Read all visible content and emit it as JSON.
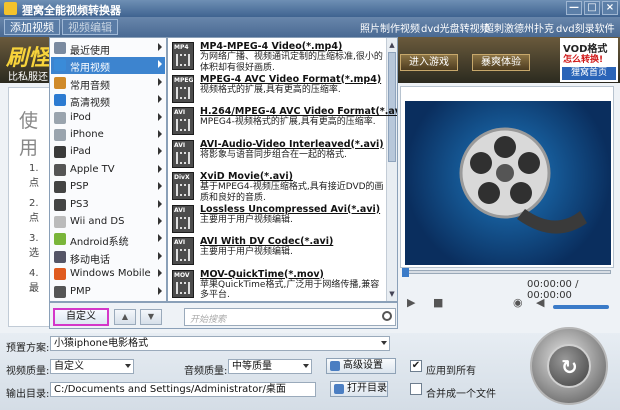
{
  "window": {
    "title": "狸窝全能视频转换器",
    "controls": [
      "—",
      "□",
      "×"
    ]
  },
  "toolbar": {
    "add_video": "添加视频",
    "video_edit": "视频编辑",
    "links": [
      "照片制作视频",
      "dvd光盘转视频",
      "超刺激德州扑克",
      "dvd刻录软件"
    ]
  },
  "banner": {
    "logo": "刷怪",
    "sub": "比私服还",
    "enter_game": "进入游戏",
    "trial": "暴爽体验",
    "vod_title": "VOD格式",
    "vod_sub": "怎么转换!",
    "vod_btn": "狸窝首页"
  },
  "leftpanel": {
    "big": "使用",
    "steps": [
      "1. 点",
      "2. 点",
      "3. 选",
      "4. 最"
    ]
  },
  "categories": [
    {
      "label": "最近使用",
      "color": "#7a8aa0"
    },
    {
      "label": "常用视频",
      "color": "#3a8bd8",
      "selected": true
    },
    {
      "label": "常用音频",
      "color": "#d08a2a"
    },
    {
      "label": "高清视频",
      "color": "#2d7bd1"
    },
    {
      "label": "iPod",
      "color": "#9aa4ae"
    },
    {
      "label": "iPhone",
      "color": "#9aa4ae"
    },
    {
      "label": "iPad",
      "color": "#3b3b3b"
    },
    {
      "label": "Apple TV",
      "color": "#555"
    },
    {
      "label": "PSP",
      "color": "#444"
    },
    {
      "label": "PS3",
      "color": "#444"
    },
    {
      "label": "Wii and DS",
      "color": "#bbb"
    },
    {
      "label": "Android系统",
      "color": "#7ab53a"
    },
    {
      "label": "移动电话",
      "color": "#556"
    },
    {
      "label": "Windows Mobile",
      "color": "#e05a1e"
    },
    {
      "label": "PMP",
      "color": "#555"
    }
  ],
  "formats": [
    {
      "tag": "MP4",
      "name": "MP4-MPEG-4 Video(*.mp4)",
      "desc": "为网络广播、视频通讯定制的压缩标准,很小的体积却有很好画质."
    },
    {
      "tag": "MPEG",
      "name": "MPEG-4 AVC Video Format(*.mp4)",
      "desc": "视频格式的扩展,具有更高的压缩率."
    },
    {
      "tag": "AVI",
      "name": "H.264/MPEG-4 AVC Video Format(*.avi)",
      "desc": "MPEG4-视频格式的扩展,具有更高的压缩率."
    },
    {
      "tag": "AVI",
      "name": "AVI-Audio-Video Interleaved(*.avi)",
      "desc": "将影象与语音同步组合在一起的格式."
    },
    {
      "tag": "DivX",
      "name": "XviD Movie(*.avi)",
      "desc": "基于MPEG4-视频压缩格式,具有接近DVD的画质和良好的音质."
    },
    {
      "tag": "AVI",
      "name": "Lossless Uncompressed Avi(*.avi)",
      "desc": "主要用于用户视频编辑."
    },
    {
      "tag": "AVI",
      "name": "AVI With DV Codec(*.avi)",
      "desc": "主要用于用户视频编辑."
    },
    {
      "tag": "MOV",
      "name": "MOV-QuickTime(*.mov)",
      "desc": "苹果QuickTime格式,广泛用于网络传播,兼容多平台."
    }
  ],
  "menu": {
    "custom": "自定义",
    "up": "▲",
    "down": "▼",
    "search_placeholder": "开始搜索"
  },
  "player": {
    "time": "00:00:00 / 00:00:00",
    "progress": 0,
    "volume": 0.85
  },
  "settings": {
    "preset_label": "预置方案:",
    "preset_value": "小猿iphone电影格式",
    "video_quality_label": "视频质量:",
    "video_quality": "自定义",
    "audio_quality_label": "音频质量:",
    "audio_quality": "中等质量",
    "advanced": "高级设置",
    "apply_all": "应用到所有",
    "output_label": "输出目录:",
    "output_path": "C:/Documents and Settings/Administrator/桌面",
    "open_dir": "打开目录",
    "merge": "合并成一个文件"
  }
}
